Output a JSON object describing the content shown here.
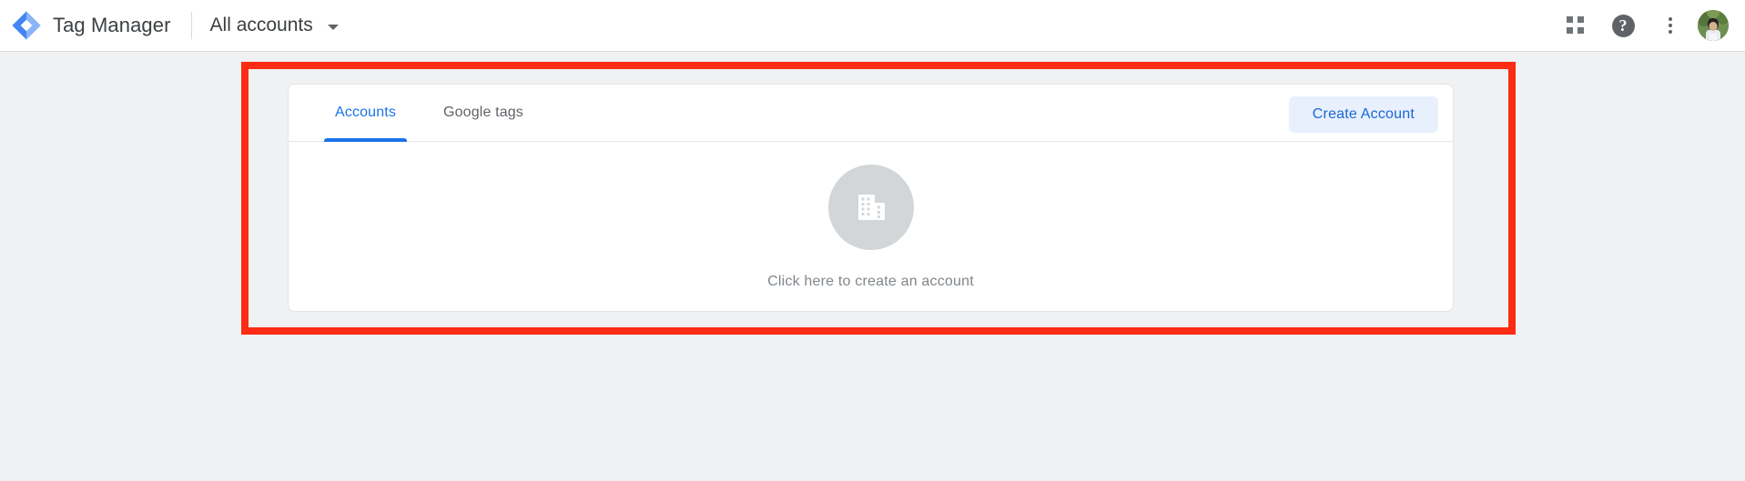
{
  "header": {
    "logo_icon": "tag-manager-diamond-logo",
    "product_title": "Tag Manager",
    "account_switcher": {
      "label": "All accounts",
      "caret_icon": "chevron-down-icon"
    },
    "actions": {
      "apps_icon": "apps-grid-icon",
      "help_icon": "help-circle-icon",
      "help_glyph": "?",
      "more_icon": "kebab-menu-icon",
      "avatar_icon": "user-avatar"
    }
  },
  "card": {
    "tabs": [
      {
        "label": "Accounts",
        "active": true
      },
      {
        "label": "Google tags",
        "active": false
      }
    ],
    "create_button_label": "Create Account",
    "empty_state": {
      "icon": "office-building-icon",
      "caption": "Click here to create an account"
    }
  },
  "annotation": {
    "type": "highlight-rectangle",
    "color": "#fb2c13"
  },
  "colors": {
    "accent_blue": "#1a73e8",
    "button_bg": "#e8f0fe",
    "button_text": "#1967d2",
    "page_background": "#eff1f2",
    "card_background": "#ffffff",
    "annotation_red": "#fb2c13",
    "muted_text": "#80868b"
  }
}
